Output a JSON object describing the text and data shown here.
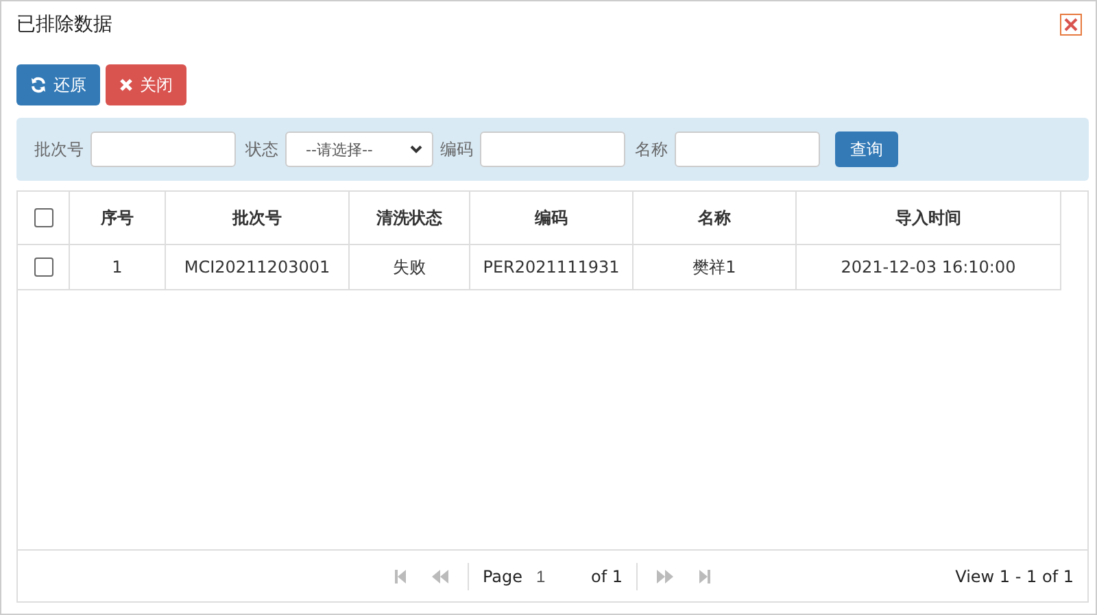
{
  "window": {
    "title": "已排除数据"
  },
  "toolbar": [
    {
      "kind": "restore",
      "label": "还原"
    },
    {
      "kind": "close",
      "label": "关闭"
    }
  ],
  "filters": [
    {
      "kind": "text",
      "label": "批次号"
    },
    {
      "kind": "select",
      "label": "状态",
      "value": "--请选择--"
    },
    {
      "kind": "text",
      "label": "编码"
    },
    {
      "kind": "text",
      "label": "名称"
    }
  ],
  "search_button": "查询",
  "table": {
    "select_all_checked": false,
    "columns": [
      "序号",
      "批次号",
      "清洗状态",
      "编码",
      "名称",
      "导入时间"
    ],
    "rows": [
      {
        "checked": false,
        "cells": [
          "1",
          "MCI20211203001",
          "失败",
          "PER2021111931",
          "樊祥1",
          "2021-12-03 16:10:00"
        ]
      }
    ]
  },
  "pager": {
    "page_label": "Page",
    "page_value": "1",
    "of_label": "of 1",
    "first_disabled": true,
    "prev_disabled": true,
    "next_disabled": true,
    "last_disabled": true,
    "summary": "View 1 - 1 of 1"
  }
}
